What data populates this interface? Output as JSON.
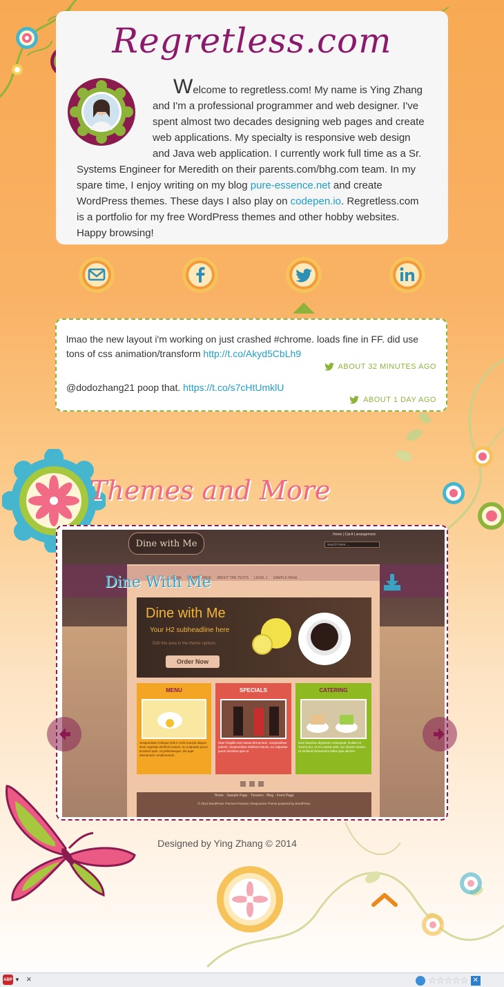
{
  "site": {
    "title": "Regretless.com"
  },
  "intro": {
    "dropcap": "W",
    "text_1": "elcome to regretless.com! My name is Ying Zhang and I'm a professional programmer and web designer. I've spent almost two decades designing web pages and create web applications. My specialty is responsive web design and Java web application. I currently work full time as a Sr. Systems Engineer for Meredith on their parents.com/bhg.com team. In my spare time, I enjoy writing on my blog ",
    "link_blog": "pure-essence.net",
    "text_2": " and create WordPress themes. These days I also play on ",
    "link_codepen": "codepen.io",
    "text_3": ". Regretless.com is a portfolio for my free WordPress themes and other hobby websites. Happy browsing!"
  },
  "social": [
    {
      "name": "email-icon"
    },
    {
      "name": "facebook-icon"
    },
    {
      "name": "twitter-icon"
    },
    {
      "name": "linkedin-icon"
    }
  ],
  "tweets": [
    {
      "text": "lmao the new layout i'm working on just crashed #chrome. loads fine in FF. did use tons of css animation/transform ",
      "link": "http://t.co/Akyd5CbLh9",
      "time": "About 32 minutes ago"
    },
    {
      "text": "@dodozhang21 poop that. ",
      "link": "https://t.co/s7cHtUmklU",
      "time": "About 1 day ago"
    }
  ],
  "themes": {
    "heading": "Themes and More",
    "slide_title": "Dine With Me",
    "preview": {
      "logo": "Dine with Me",
      "top_links": "Home | Cat A | arrangement",
      "search_placeholder": "search here ...",
      "nav": [
        "HOME",
        "SAMPLE PAGE",
        "ABOUT THE TESTS",
        "LEVEL 1",
        "SAMPLE PAGE"
      ],
      "hero_title": "Dine with Me",
      "hero_sub": "Your H2 subheadline here",
      "hero_note": "Edit this area in the theme options.",
      "hero_button": "Order Now",
      "cards": [
        {
          "title": "MENU",
          "text": "Suspendisse tristique felis in velit suscipit aliquet. Nunc egestas eleifend mauris, eu vulputate purus tincidunt quis. Ut pellentesque, dui eget elementum condimentum."
        },
        {
          "title": "SPECIALS",
          "text": "vitae fringilla erat massa fermentum. Suspendisse potenti. Suspendisse eleifend mauris, eu vulputate purus tincidunt quis ut."
        },
        {
          "title": "CATERING",
          "text": "Nam faucibus dignissim consequat. Nullam et viverra dui. Ut eu massa velit, non dictum massa. Ut eleifend elementum tellus quis ultrices."
        }
      ],
      "footer_links": "Home · Sample Page · Tivoamo · Blog · Front Page",
      "footer_copy": "© 2013 WordPress Themes Preview | Responsive Theme powered by WordPress"
    }
  },
  "footer": {
    "credit": "Designed by Ying Zhang © 2014"
  },
  "colors": {
    "title": "#8b1a6b",
    "link": "#1f9ec4",
    "tweet_accent": "#8db33a",
    "heading_pink": "#ef6a83",
    "slider_border": "#8b1a4f"
  },
  "statusbar": {
    "adblock_label": "ABP",
    "close": "×"
  }
}
